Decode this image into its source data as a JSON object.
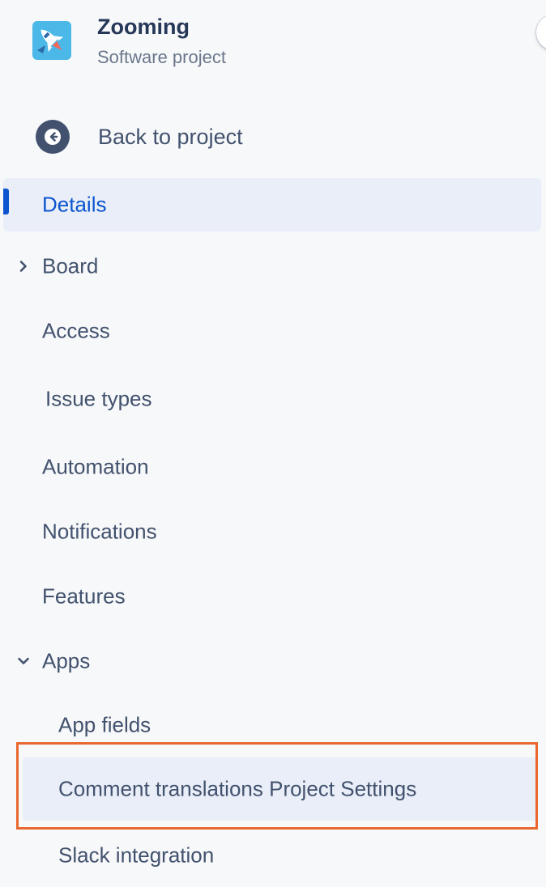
{
  "project": {
    "name": "Zooming",
    "type": "Software project",
    "logo_icon": "rocket-icon"
  },
  "back": {
    "label": "Back to project",
    "icon": "arrow-left-icon"
  },
  "nav": {
    "details": "Details",
    "board": "Board",
    "access": "Access",
    "issue_types": "Issue types",
    "automation": "Automation",
    "notifications": "Notifications",
    "features": "Features",
    "apps": "Apps"
  },
  "apps_children": {
    "app_fields": "App fields",
    "comment_translations": "Comment translations Project Settings",
    "slack_integration": "Slack integration"
  },
  "colors": {
    "selected_text": "#0c55cf",
    "selected_bg": "#e9eef8",
    "highlight_outline": "#e8682f",
    "logo_bg": "#4bb8e8"
  }
}
